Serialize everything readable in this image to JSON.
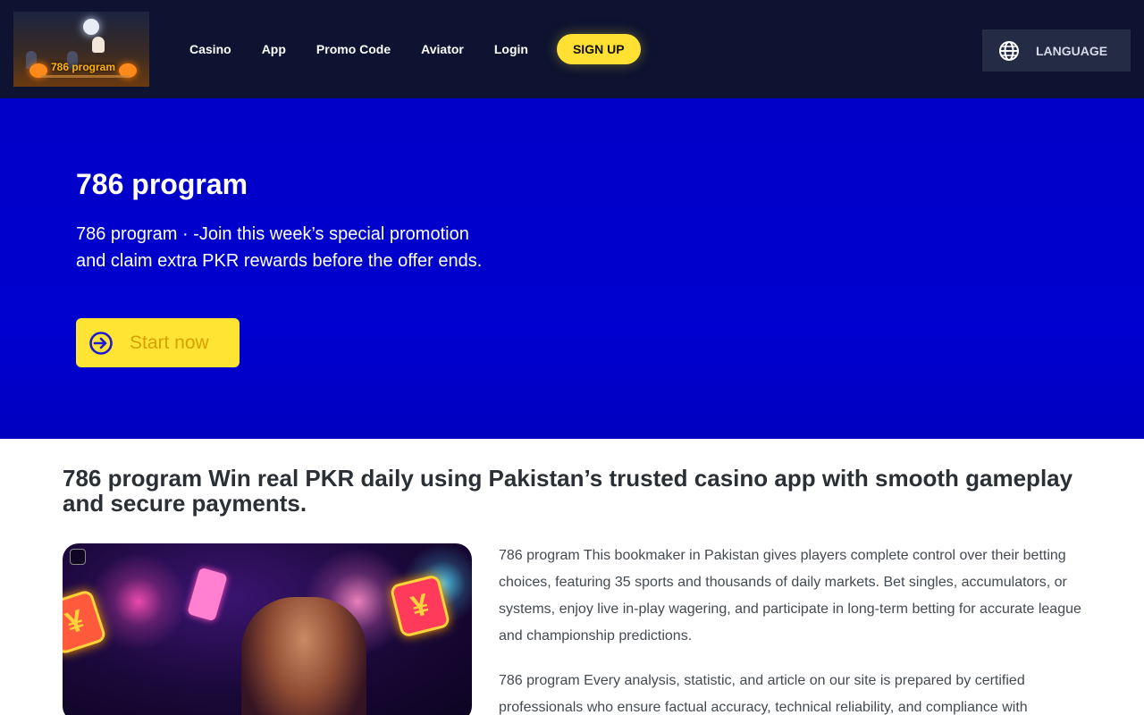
{
  "header": {
    "logo_text": "786 program",
    "nav": [
      {
        "label": "Casino"
      },
      {
        "label": "App"
      },
      {
        "label": "Promo Code"
      },
      {
        "label": "Aviator"
      },
      {
        "label": "Login"
      }
    ],
    "signup_label": "SIGN UP",
    "language_label": "LANGUAGE"
  },
  "hero": {
    "title": "786 program",
    "text": "786 program · -Join this week’s special promotion and claim extra PKR rewards before the offer ends.",
    "cta_label": "Start now"
  },
  "content": {
    "title": "786 program Win real PKR daily using Pakistan’s trusted casino app with smooth gameplay and secure payments.",
    "image_tile_symbol": "¥",
    "paragraphs": [
      "786 program This bookmaker in Pakistan gives players complete control over their betting choices, featuring 35 sports and thousands of daily markets. Bet singles, accumulators, or systems, enjoy live in-play wagering, and participate in long-term betting for accurate league and championship predictions.",
      "786 program Every analysis, statistic, and article on our site is prepared by certified professionals who ensure factual accuracy, technical reliability, and compliance with"
    ]
  },
  "colors": {
    "header_bg": "#0d1330",
    "hero_bg": "#0000c8",
    "accent_yellow": "#ffe033",
    "language_bg": "#232b45"
  },
  "icons": {
    "language": "globe-icon",
    "cta": "arrow-right-circle-icon"
  }
}
